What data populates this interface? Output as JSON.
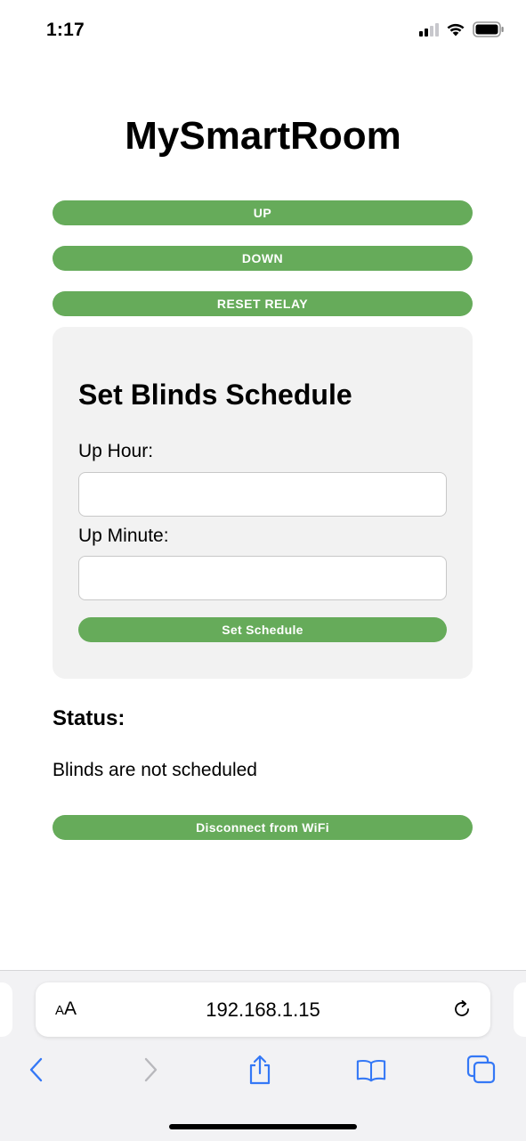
{
  "status_bar": {
    "time": "1:17"
  },
  "page": {
    "title": "MySmartRoom",
    "buttons": {
      "up": "UP",
      "down": "DOWN",
      "reset_relay": "RESET RELAY",
      "disconnect": "Disconnect from WiFi"
    },
    "accent_color": "#66ab5a"
  },
  "schedule": {
    "title": "Set Blinds Schedule",
    "up_hour_label": "Up Hour:",
    "up_hour_value": "",
    "up_minute_label": "Up Minute:",
    "up_minute_value": "",
    "submit_label": "Set Schedule"
  },
  "status": {
    "heading": "Status:",
    "text": "Blinds are not scheduled"
  },
  "browser": {
    "text_size_label_small": "A",
    "text_size_label_large": "A",
    "url": "192.168.1.15",
    "icons": [
      "reload-icon",
      "back-icon",
      "forward-icon",
      "share-icon",
      "bookmarks-icon",
      "tabs-icon"
    ]
  }
}
